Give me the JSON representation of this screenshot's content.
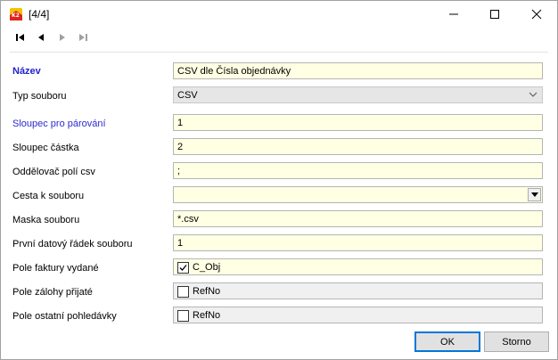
{
  "window": {
    "title": "[4/4]",
    "controls": {
      "minimize": "—",
      "maximize": "☐",
      "close": "✕"
    }
  },
  "toolbar": {
    "buttons": [
      {
        "name": "first-record",
        "icon": "first-icon"
      },
      {
        "name": "previous-record",
        "icon": "prev-icon"
      },
      {
        "name": "next-record",
        "icon": "next-icon",
        "disabled": true
      },
      {
        "name": "last-record",
        "icon": "last-icon",
        "disabled": true
      }
    ]
  },
  "form": {
    "nazev": {
      "label": "Název",
      "value": "CSV dle Čísla objednávky"
    },
    "typ_souboru": {
      "label": "Typ souboru",
      "value": "CSV"
    },
    "sloupec_parovani": {
      "label": "Sloupec pro párování",
      "value": "1"
    },
    "sloupec_castka": {
      "label": "Sloupec částka",
      "value": "2"
    },
    "oddelovac": {
      "label": "Oddělovač polí csv",
      "value": ";"
    },
    "cesta": {
      "label": "Cesta k souboru",
      "value": ""
    },
    "maska": {
      "label": "Maska souboru",
      "value": "*.csv"
    },
    "prvni_radek": {
      "label": "První datový řádek souboru",
      "value": "1"
    },
    "pole_faktury": {
      "label": "Pole faktury vydané",
      "value": "C_Obj",
      "checked": true
    },
    "pole_zalohy": {
      "label": "Pole zálohy přijaté",
      "value": "RefNo",
      "checked": false
    },
    "pole_ostatni": {
      "label": "Pole ostatní pohledávky",
      "value": "RefNo",
      "checked": false
    }
  },
  "buttons": {
    "ok": "OK",
    "cancel": "Storno"
  },
  "colors": {
    "field_bg": "#ffffe3",
    "label_accent": "#2222cc",
    "default_button_border": "#0078d7"
  }
}
